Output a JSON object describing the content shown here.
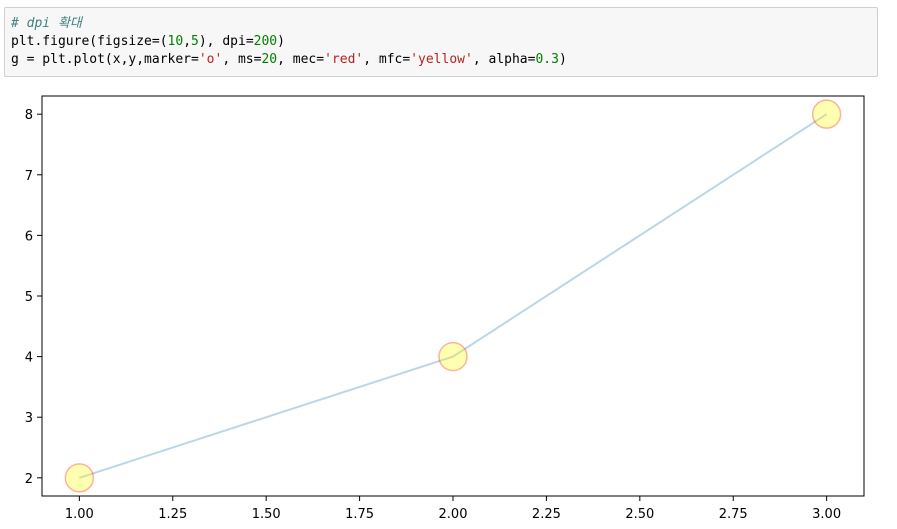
{
  "code": {
    "comment": "# dpi 확대",
    "line2": {
      "a": "plt.figure(figsize=(",
      "b": "10",
      "c": ",",
      "d": "5",
      "e": "), dpi=",
      "f": "200",
      "g": ")"
    },
    "line3": {
      "a": "g = plt.plot(x,y,marker=",
      "b": "'o'",
      "c": ", ms=",
      "d": "20",
      "e": ", mec=",
      "f": "'red'",
      "g": ", mfc=",
      "h": "'yellow'",
      "i": ", alpha=",
      "j": "0.3",
      "k": ")"
    }
  },
  "chart_data": {
    "type": "line",
    "x": [
      1.0,
      2.0,
      3.0
    ],
    "y": [
      2,
      4,
      8
    ],
    "xlim": [
      0.9,
      3.1
    ],
    "ylim": [
      1.7,
      8.3
    ],
    "xticks": [
      1.0,
      1.25,
      1.5,
      1.75,
      2.0,
      2.25,
      2.5,
      2.75,
      3.0
    ],
    "xtick_labels": [
      "1.00",
      "1.25",
      "1.50",
      "1.75",
      "2.00",
      "2.25",
      "2.50",
      "2.75",
      "3.00"
    ],
    "yticks": [
      2,
      3,
      4,
      5,
      6,
      7,
      8
    ],
    "ytick_labels": [
      "2",
      "3",
      "4",
      "5",
      "6",
      "7",
      "8"
    ],
    "marker": "o",
    "line_color": "#1f77b4",
    "marker_edge_color": "#ff0000",
    "marker_face_color": "#ffff00",
    "alpha": 0.3,
    "grid": false
  }
}
